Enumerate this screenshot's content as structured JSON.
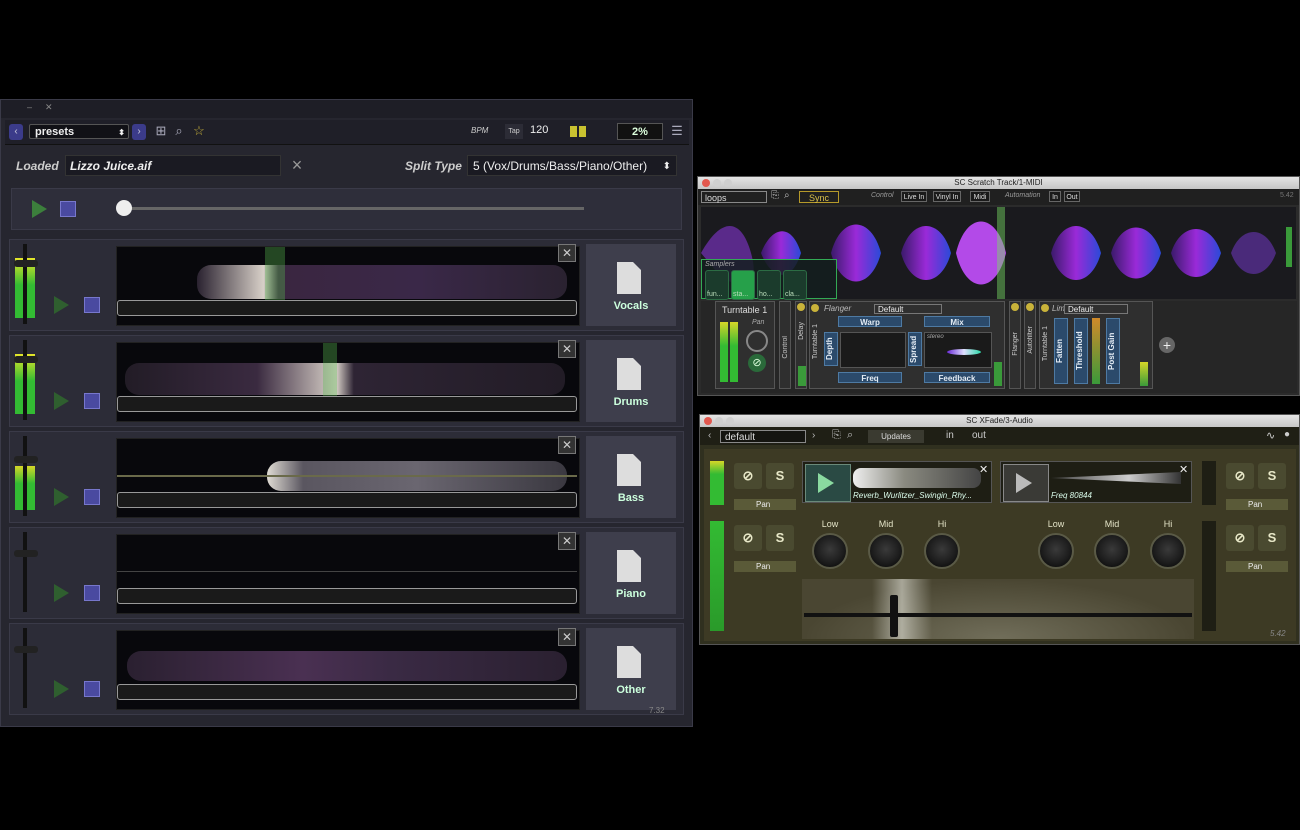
{
  "splitter": {
    "toolbar": {
      "preset": "presets",
      "bpm_label": "BPM",
      "tap_label": "Tap",
      "bpm_value": "120",
      "percent": "2%"
    },
    "loaded_label": "Loaded",
    "loaded_file": "Lizzo Juice.aif",
    "split_type_label": "Split Type",
    "split_type_value": "5 (Vox/Drums/Bass/Piano/Other)",
    "stems": [
      {
        "label": "Vocals"
      },
      {
        "label": "Drums"
      },
      {
        "label": "Bass"
      },
      {
        "label": "Piano"
      },
      {
        "label": "Other"
      }
    ],
    "version": "7.32"
  },
  "scratch": {
    "title": "SC Scratch Track/1-MIDI",
    "loops": "loops",
    "sync_label": "Sync",
    "control_label": "Control",
    "live_in": "Live In",
    "vinyl_in": "Vinyl In",
    "midi": "Midi",
    "automation_label": "Automation",
    "in": "In",
    "out": "Out",
    "version": "5.42",
    "samplers": {
      "label": "Samplers",
      "pads": [
        "fun...",
        "sta...",
        "ho...",
        "cla..."
      ]
    },
    "turntable": {
      "title": "Turntable 1",
      "pan": "Pan"
    },
    "control_vertical": "Control",
    "delay_vertical": "Delay",
    "flanger": {
      "name": "Flanger",
      "preset": "Default",
      "side_label": "Turntable 1",
      "warp": "Warp",
      "mix": "Mix",
      "depth": "Depth",
      "spread": "Spread",
      "stereo": "stereo",
      "freq": "Freq",
      "feedback": "Feedback"
    },
    "flanger_vertical": "Flanger",
    "autofilter_vertical": "Autofilter",
    "limiter": {
      "name": "Lim",
      "preset": "Default",
      "side_label": "Turntable 1",
      "fatten": "Fatten",
      "threshold": "Threshold",
      "post_gain": "Post Gain"
    }
  },
  "xfade": {
    "title": "SC XFade/3-Audio",
    "preset": "default",
    "updates": "Updates",
    "in": "in",
    "out": "out",
    "version": "5.42",
    "pan": "Pan",
    "eq": [
      "Low",
      "Mid",
      "Hi"
    ],
    "deck_a": "Reverb_Wurlitzer_Swingin_Rhy...",
    "deck_b": "Freq 80844",
    "mute_glyph": "⊘",
    "solo_glyph": "S"
  },
  "colors": {
    "splitter_bg": "#26262f",
    "accent_blue": "#4a4aa0",
    "play_green": "#3c7f3c",
    "meter_green": "#35c43a",
    "meter_yellow": "#d6d628",
    "scratch_purple": "#8a2be2",
    "xfade_bg": "#3d3a24",
    "sync_gold": "#d9c04a"
  },
  "icons": [
    "chevron-left-icon",
    "chevron-right-icon",
    "add-folder-icon",
    "search-icon",
    "star-icon",
    "menu-icon",
    "play-icon",
    "stop-icon",
    "close-icon",
    "document-icon",
    "link-icon",
    "plus-icon",
    "waveform-icon",
    "user-icon"
  ]
}
